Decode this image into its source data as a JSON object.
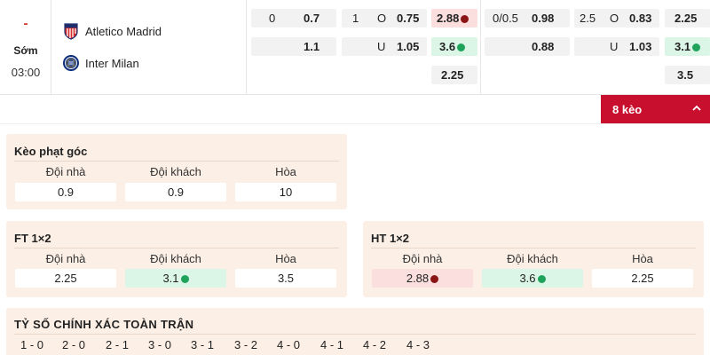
{
  "match": {
    "dash": "-",
    "status": "Sớm",
    "kickoff": "03:00",
    "home_team": "Atletico Madrid",
    "away_team": "Inter Milan",
    "odds": {
      "h1": [
        "0",
        "0.7",
        "1",
        "O",
        "0.75",
        "2.88"
      ],
      "a1": [
        "1.1",
        "U",
        "1.05",
        "3.6"
      ],
      "d1": "2.25",
      "h2": [
        "0/0.5",
        "0.98",
        "2.5",
        "O",
        "0.83",
        "2.25"
      ],
      "a2": [
        "0.88",
        "U",
        "1.03",
        "3.1"
      ],
      "d2": "3.5"
    }
  },
  "bets_button": {
    "label": "8 kèo"
  },
  "corner": {
    "title": "Kèo phạt góc",
    "labels": [
      "Đội nhà",
      "Đội khách",
      "Hòa"
    ],
    "values": [
      "0.9",
      "0.9",
      "10"
    ]
  },
  "ft": {
    "title": "FT 1×2",
    "labels": [
      "Đội nhà",
      "Đội khách",
      "Hòa"
    ],
    "values": [
      "2.25",
      "3.1",
      "3.5"
    ]
  },
  "ht": {
    "title": "HT 1×2",
    "labels": [
      "Đội nhà",
      "Đội khách",
      "Hòa"
    ],
    "values": [
      "2.88",
      "3.6",
      "2.25"
    ]
  },
  "exact": {
    "title": "TỶ SỐ CHÍNH XÁC TOÀN TRẬN",
    "scores": [
      "1 - 0",
      "2 - 0",
      "2 - 1",
      "3 - 0",
      "3 - 1",
      "3 - 2",
      "4 - 0",
      "4 - 1",
      "4 - 2",
      "4 - 3"
    ]
  },
  "colors": {
    "accent": "#c8102e",
    "down": "#8b1414",
    "up": "#1fa35a",
    "card": "#fcefe6"
  }
}
